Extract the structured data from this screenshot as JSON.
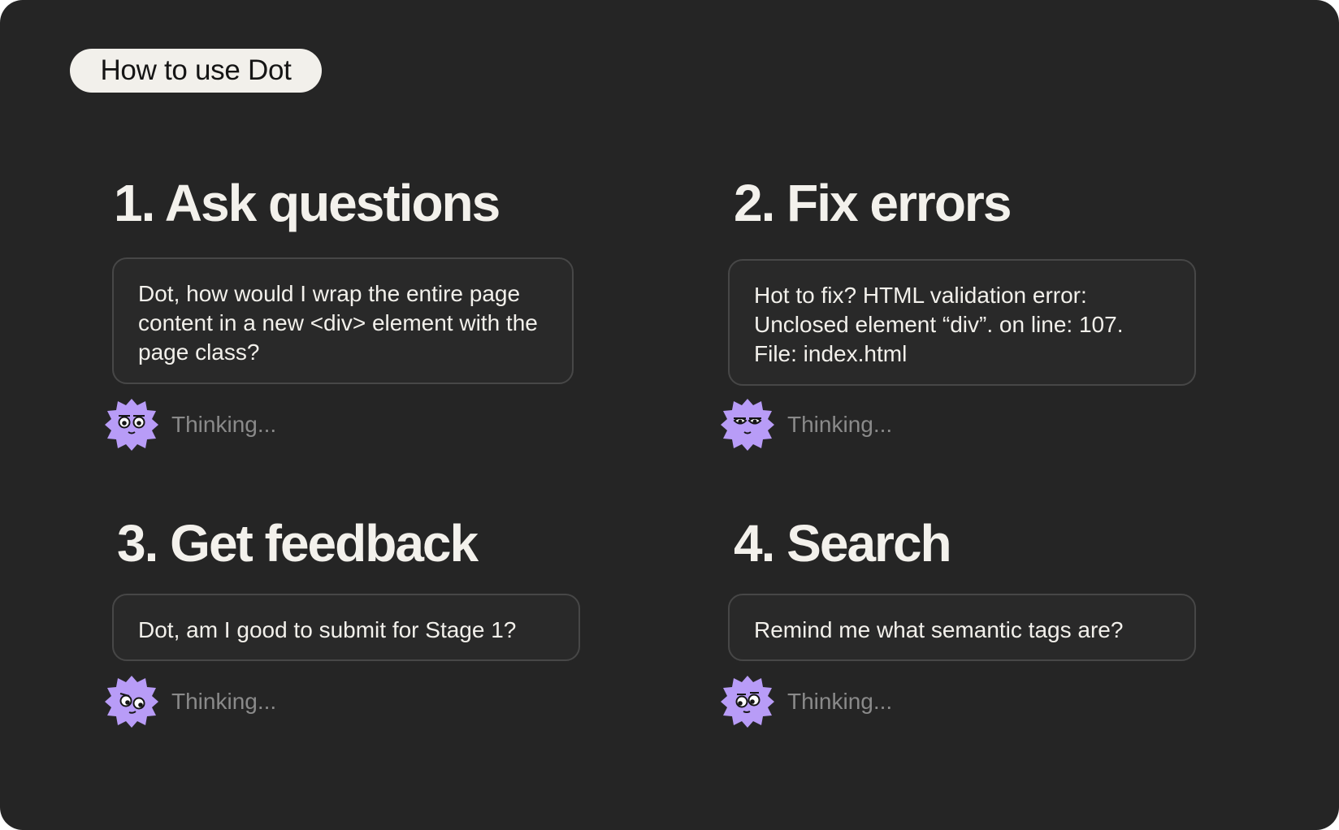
{
  "badge": {
    "label": "How to use Dot"
  },
  "sections": [
    {
      "title": "1. Ask questions",
      "message": "Dot, how would I wrap the entire page content in a new <div> element with the page class?",
      "status": "Thinking..."
    },
    {
      "title": "2. Fix errors",
      "message": "Hot to fix? HTML validation error: Unclosed element “div”. on line: 107. File: index.html",
      "status": "Thinking..."
    },
    {
      "title": "3. Get feedback",
      "message": "Dot, am I good to submit for Stage 1?",
      "status": "Thinking..."
    },
    {
      "title": "4. Search",
      "message": "Remind me what semantic tags are?",
      "status": "Thinking..."
    }
  ],
  "colors": {
    "background": "#252525",
    "badge": "#f2f0eb",
    "heading": "#f3f1ec",
    "message_border": "#474747",
    "status_text": "#8a8a8a",
    "avatar": "#b89cf7"
  },
  "icons": {
    "avatar": "dot-mascot-icon"
  }
}
